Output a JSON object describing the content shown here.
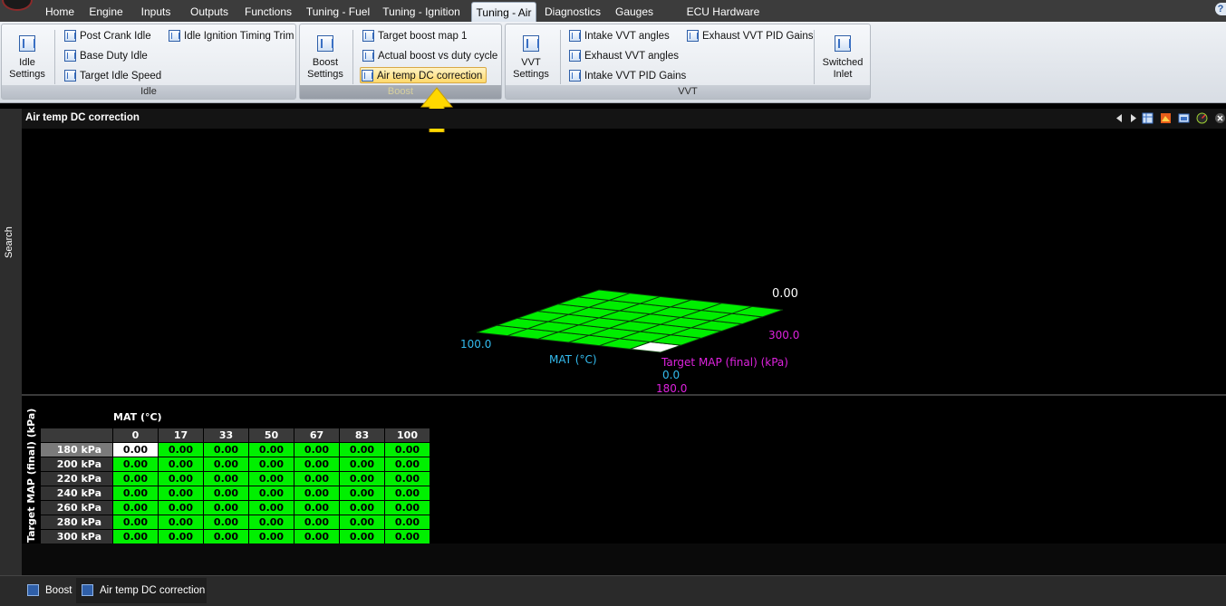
{
  "menu": {
    "tabs": [
      "Home",
      "Engine",
      "Inputs",
      "Outputs",
      "Functions",
      "Tuning - Fuel",
      "Tuning - Ignition",
      "Tuning - Air",
      "Diagnostics",
      "Gauges",
      "ECU Hardware Settings"
    ],
    "active_tab": "Tuning - Air",
    "help": "?"
  },
  "ribbon": {
    "idle": {
      "title": "Idle",
      "big": "Idle Settings",
      "items": [
        "Post Crank Idle",
        "Base Duty Idle",
        "Target Idle Speed",
        "Idle Ignition Timing Trim"
      ]
    },
    "boost": {
      "title": "Boost",
      "big": "Boost Settings",
      "items": [
        "Target boost map 1",
        "Actual boost vs duty cycle",
        "Air temp DC correction"
      ],
      "selected": "Air temp DC correction"
    },
    "vvt": {
      "title": "VVT",
      "big": "VVT Settings",
      "items": [
        "Intake VVT angles",
        "Exhaust VVT angles",
        "Intake VVT PID Gains",
        "Exhaust VVT PID Gains"
      ],
      "big2": "Switched Inlet"
    }
  },
  "sidebar": {
    "search": "Search"
  },
  "document": {
    "title": "Air temp DC correction"
  },
  "plot3d": {
    "value_label": "0.00",
    "mat_axis": "MAT (°C)",
    "map_axis": "Target MAP (final) (kPa)",
    "mat_max": "100.0",
    "mat_min": "0.0",
    "map_max": "300.0",
    "map_min": "180.0",
    "colors": {
      "surface": "#00ee00",
      "mat": "#33bbee",
      "map": "#dd22dd",
      "selected": "#ffffff"
    }
  },
  "table": {
    "col_axis": "MAT (°C)",
    "row_axis": "Target MAP (final) (kPa)",
    "columns": [
      "0",
      "17",
      "33",
      "50",
      "67",
      "83",
      "100"
    ],
    "rows": [
      "180 kPa",
      "200 kPa",
      "220 kPa",
      "240 kPa",
      "260 kPa",
      "280 kPa",
      "300 kPa"
    ],
    "values": [
      [
        "0.00",
        "0.00",
        "0.00",
        "0.00",
        "0.00",
        "0.00",
        "0.00"
      ],
      [
        "0.00",
        "0.00",
        "0.00",
        "0.00",
        "0.00",
        "0.00",
        "0.00"
      ],
      [
        "0.00",
        "0.00",
        "0.00",
        "0.00",
        "0.00",
        "0.00",
        "0.00"
      ],
      [
        "0.00",
        "0.00",
        "0.00",
        "0.00",
        "0.00",
        "0.00",
        "0.00"
      ],
      [
        "0.00",
        "0.00",
        "0.00",
        "0.00",
        "0.00",
        "0.00",
        "0.00"
      ],
      [
        "0.00",
        "0.00",
        "0.00",
        "0.00",
        "0.00",
        "0.00",
        "0.00"
      ],
      [
        "0.00",
        "0.00",
        "0.00",
        "0.00",
        "0.00",
        "0.00",
        "0.00"
      ]
    ]
  },
  "taskbar": {
    "tabs": [
      "Boost",
      "Air temp DC correction"
    ],
    "active": "Air temp DC correction"
  }
}
